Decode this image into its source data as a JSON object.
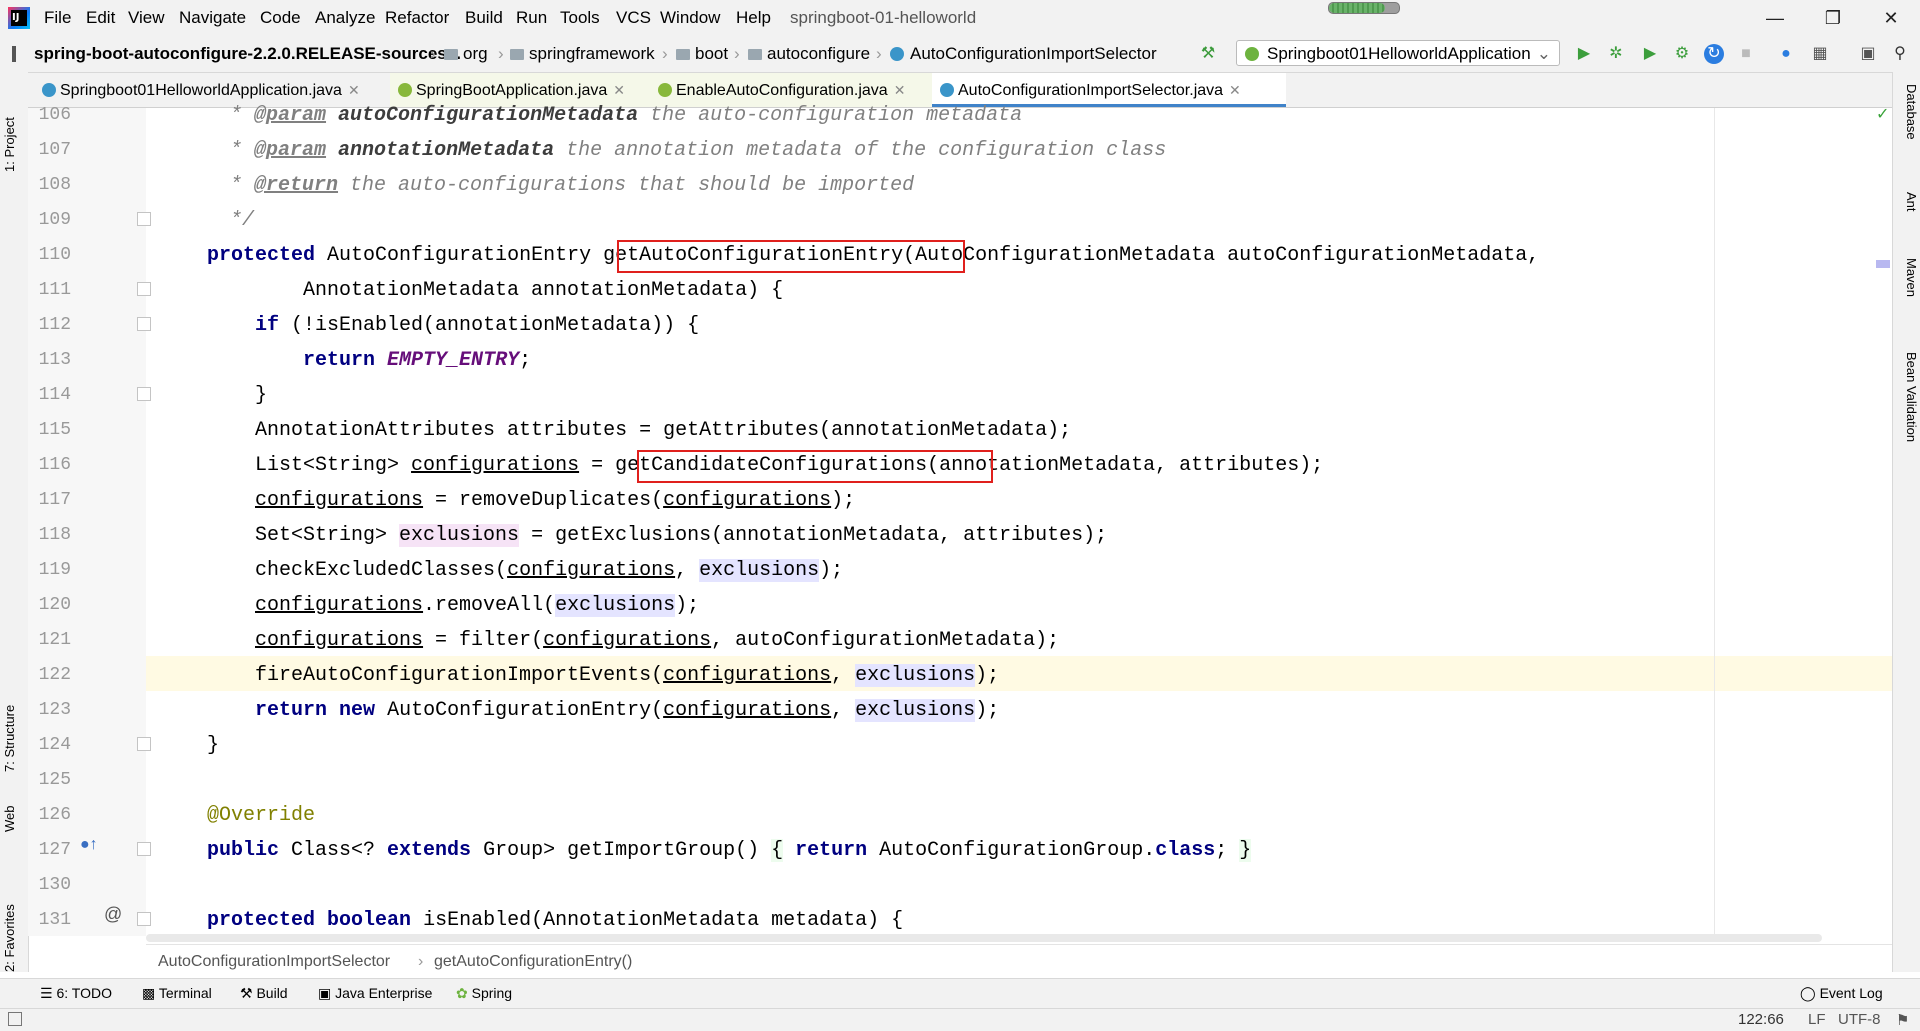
{
  "menubar": {
    "items": [
      "File",
      "Edit",
      "View",
      "Navigate",
      "Code",
      "Analyze",
      "Refactor",
      "Build",
      "Run",
      "Tools",
      "VCS",
      "Window",
      "Help"
    ],
    "project_title": "springboot-01-helloworld"
  },
  "navbar": {
    "crumbs": [
      "spring-boot-autoconfigure-2.2.0.RELEASE-sources...",
      "org",
      "springframework",
      "boot",
      "autoconfigure",
      "AutoConfigurationImportSelector"
    ],
    "run_config": "Springboot01HelloworldApplication"
  },
  "tabs": [
    {
      "label": "Springboot01HelloworldApplication.java",
      "active": false
    },
    {
      "label": "SpringBootApplication.java",
      "active": false
    },
    {
      "label": "EnableAutoConfiguration.java",
      "active": false
    },
    {
      "label": "AutoConfigurationImportSelector.java",
      "active": true
    }
  ],
  "left_tools": [
    "1: Project",
    "7: Structure",
    "Web",
    "2: Favorites"
  ],
  "right_tools": [
    "Database",
    "Ant",
    "Maven",
    "Bean Validation"
  ],
  "line_numbers": [
    "106",
    "107",
    "108",
    "109",
    "110",
    "111",
    "112",
    "113",
    "114",
    "115",
    "116",
    "117",
    "118",
    "119",
    "120",
    "121",
    "122",
    "123",
    "124",
    "125",
    "126",
    "127",
    "130",
    "131"
  ],
  "breadcrumb_bottom": [
    "AutoConfigurationImportSelector",
    "getAutoConfigurationEntry()"
  ],
  "bottom_tools": [
    "6: TODO",
    "Terminal",
    "Build",
    "Java Enterprise",
    "Spring",
    "Event Log"
  ],
  "status": {
    "position": "122:66",
    "line_sep": "LF",
    "encoding": "UTF-8"
  }
}
